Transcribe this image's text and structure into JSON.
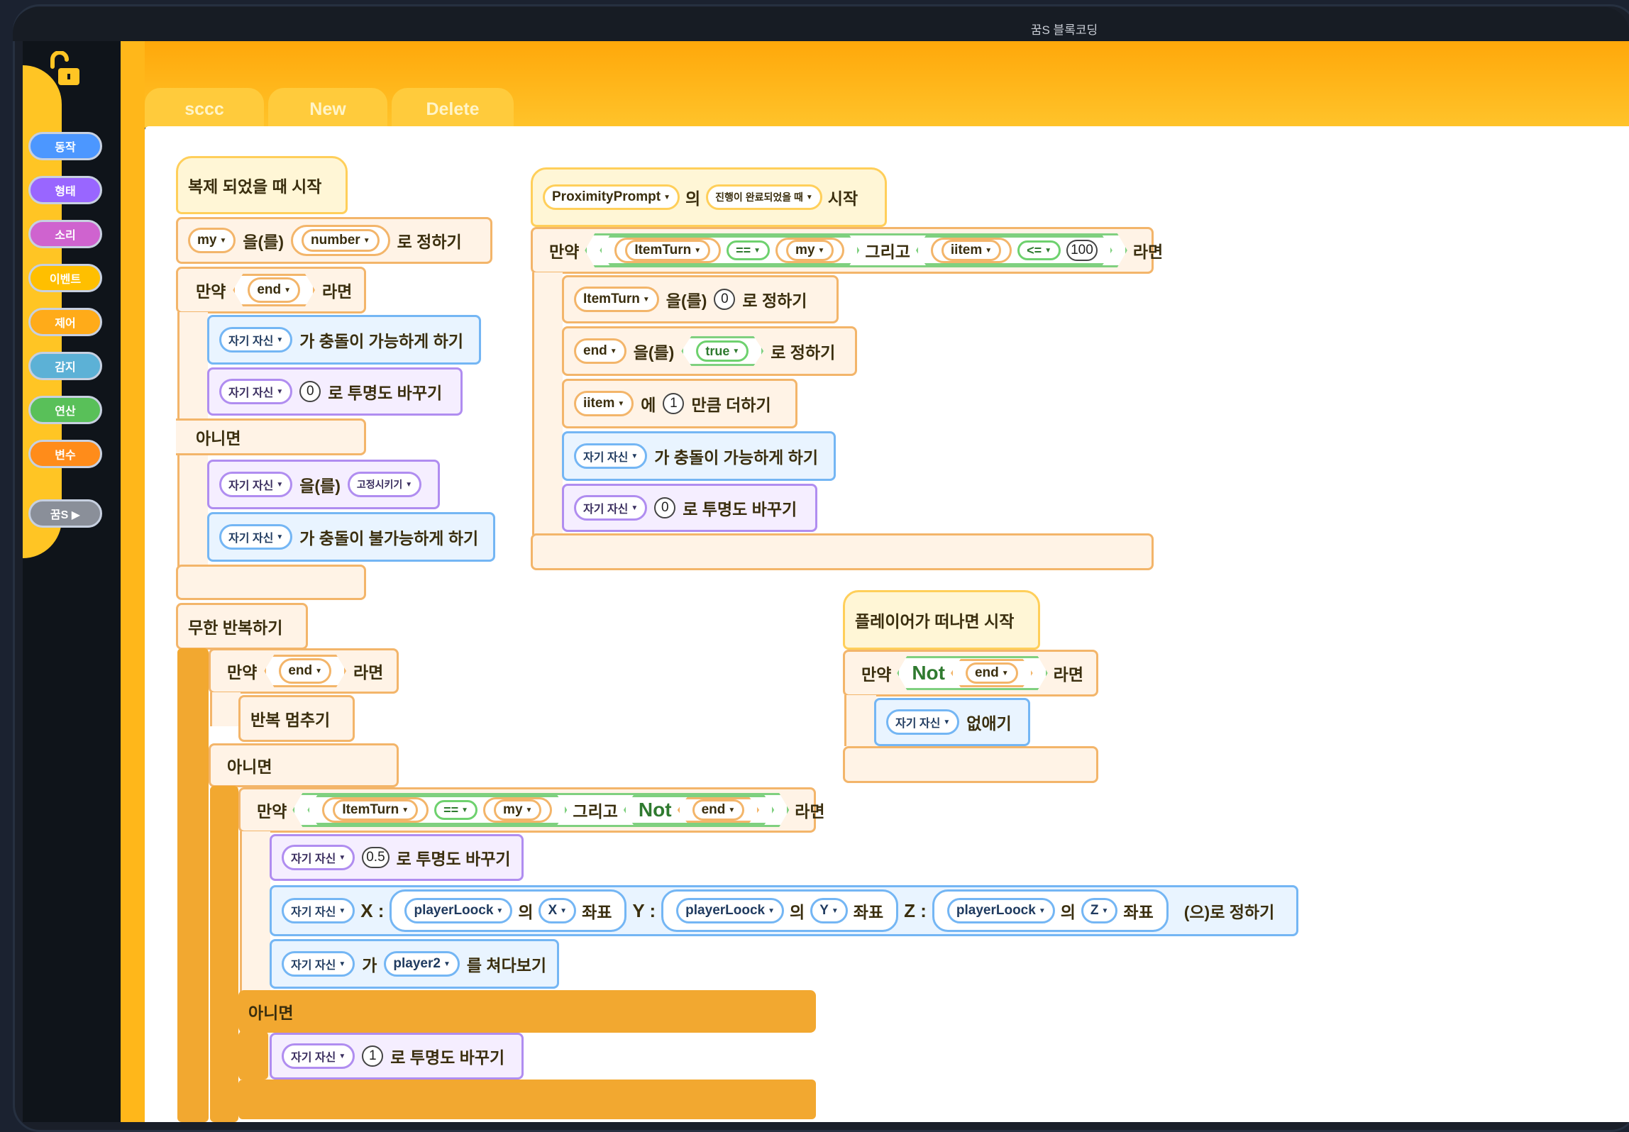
{
  "window": {
    "title": "꿈S 블록코딩"
  },
  "categories": [
    {
      "label": "동작",
      "color": "#4c97ff"
    },
    {
      "label": "형태",
      "color": "#9966ff"
    },
    {
      "label": "소리",
      "color": "#cf63cf"
    },
    {
      "label": "이벤트",
      "color": "#ffbf00"
    },
    {
      "label": "제어",
      "color": "#ffab19"
    },
    {
      "label": "감지",
      "color": "#5cb1d6"
    },
    {
      "label": "연산",
      "color": "#59c059"
    },
    {
      "label": "변수",
      "color": "#ff8c1a"
    },
    {
      "label": "꿈S ▶",
      "color": "#8a8f99"
    }
  ],
  "tabs": [
    "sccc",
    "New",
    "Delete"
  ],
  "words": {
    "set": "을(를)",
    "set_to": "로 정하기",
    "if": "만약",
    "then": "라면",
    "else": "아니면",
    "and": "그리고",
    "not": "Not",
    "of": "의",
    "start": "시작",
    "add_by": "만큼 더하기",
    "to": "에",
    "change_transparency": "로 투명도 바꾸기",
    "collide_on": "가 충돌이 가능하게 하기",
    "collide_off": "가 충돌이 불가능하게 하기",
    "forever": "무한 반복하기",
    "stop_loop": "반복 멈추기",
    "delete": "없애기",
    "look_at": "를 쳐다보기",
    "subject": "가",
    "coord": "좌표",
    "set_pos": "(으)로 정하기",
    "x_label": "X :",
    "y_label": "Y :",
    "z_label": "Z :"
  },
  "dropdowns": {
    "self": "자기 자신",
    "my": "my",
    "number": "number",
    "end": "end",
    "item_turn": "ItemTurn",
    "iitem": "iitem",
    "true": "true",
    "anchored": "고정시키기",
    "proximity": "ProximityPrompt",
    "prompt_done": "진행이 완료되었을 때",
    "eq": "==",
    "le": "<=",
    "player_loock": "playerLoock",
    "x": "X",
    "y": "Y",
    "z": "Z",
    "player2": "player2"
  },
  "numbers": {
    "zero": "0",
    "one": "1",
    "hundred": "100",
    "half": "0.5"
  },
  "hats": {
    "clone": "복제 되었을 때 시작",
    "player_leave": "플레이어가 떠나면 시작"
  }
}
